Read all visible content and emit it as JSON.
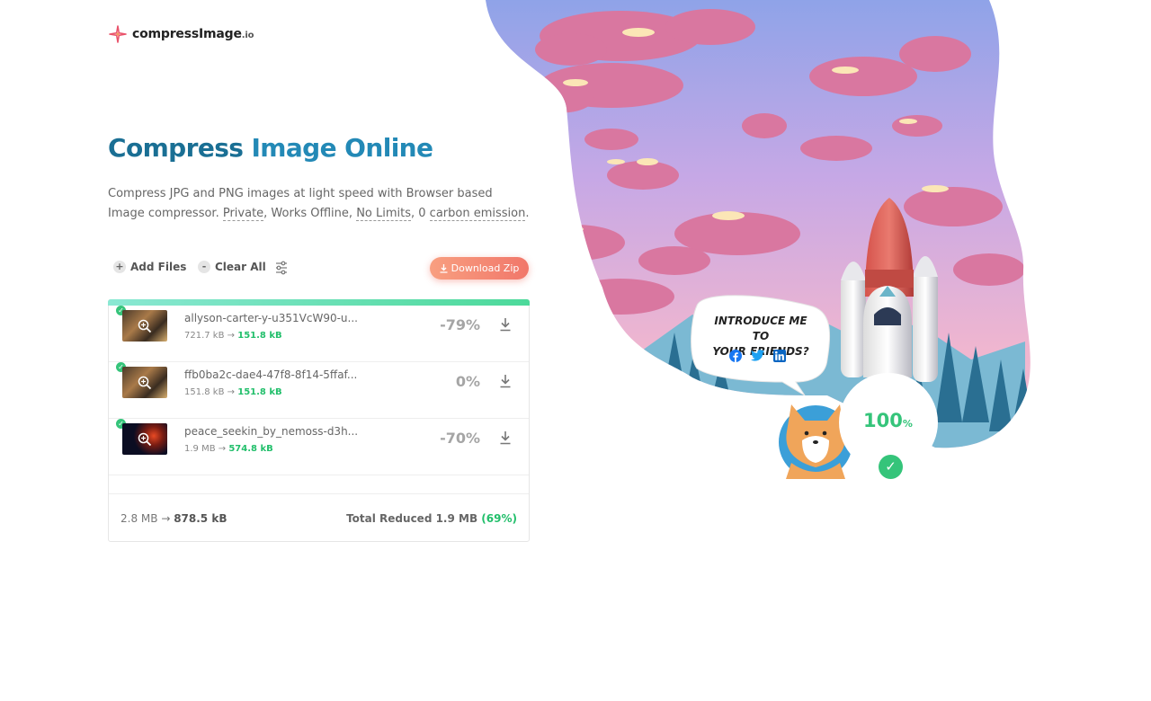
{
  "brand": {
    "name": "compressImage",
    "tld": ".io"
  },
  "hero": {
    "title_part1": "Compress ",
    "title_part2": "Image Online",
    "desc_start": "Compress JPG and PNG images at light speed with Browser based Image compressor. ",
    "desc_private": "Private",
    "desc_mid": ", Works Offline, ",
    "desc_nolimits": "No Limits",
    "desc_zero": ", 0 ",
    "desc_carbon": "carbon emission",
    "desc_end": "."
  },
  "toolbar": {
    "add_icon": "+",
    "add_label": "Add Files",
    "clear_icon": "-",
    "clear_label": "Clear All",
    "settings_icon": "sliders-icon",
    "download_zip_label": "Download Zip"
  },
  "files": [
    {
      "name": "allyson-carter-y-u351VcW90-u...",
      "original": "721.7 kB",
      "compressed": "151.8 kB",
      "percent": "-79%"
    },
    {
      "name": "ffb0ba2c-dae4-47f8-8f14-5ffaf...",
      "original": "151.8 kB",
      "compressed": "151.8 kB",
      "percent": "0%"
    },
    {
      "name": "peace_seekin_by_nemoss-d3h...",
      "original": "1.9 MB",
      "compressed": "574.8 kB",
      "percent": "-70%"
    }
  ],
  "arrow": "→",
  "progress_fraction": 1.0,
  "summary": {
    "total_original": "2.8 MB",
    "total_compressed": "878.5 kB",
    "reduced_label": "Total Reduced 1.9 MB",
    "reduced_percent": "(69%)"
  },
  "promo": {
    "line1": "INTRODUCE ME TO",
    "line2": "YOUR FRIENDS?",
    "share": [
      "facebook-icon",
      "twitter-icon",
      "linkedin-icon"
    ],
    "percent_value": "100",
    "percent_sign": "%",
    "check": "✓"
  },
  "colors": {
    "title": "#1a6f94",
    "accent_green": "#35c47a",
    "download_btn": "#f1776a"
  }
}
